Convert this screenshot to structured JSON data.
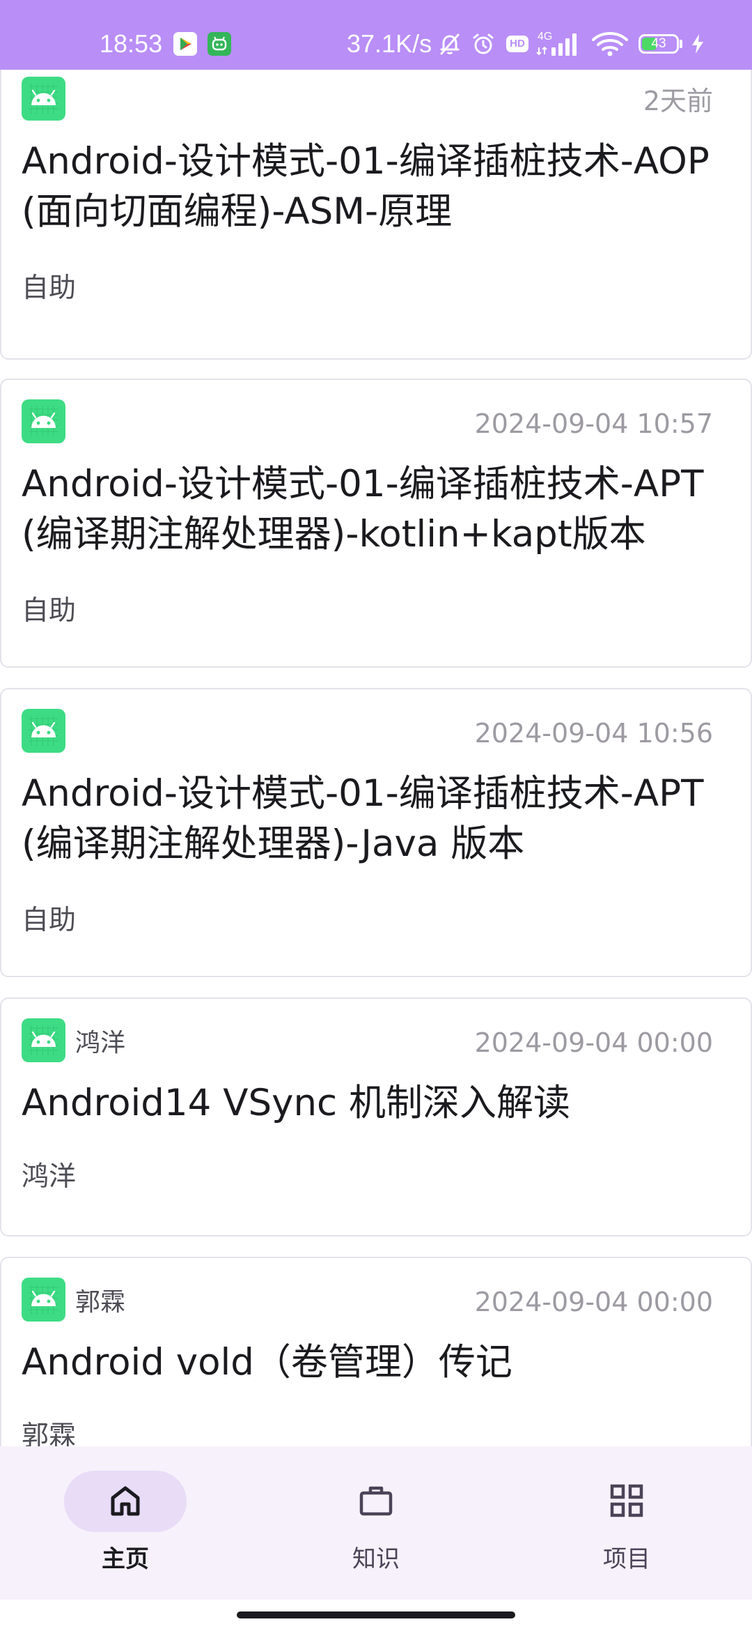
{
  "status_bar": {
    "time": "18:53",
    "network_speed": "37.1K/s",
    "hd_label": "HD",
    "network_type": "4G",
    "battery_level": "43",
    "battery_fraction": 0.43,
    "icons": [
      "play-store-icon",
      "green-app-icon",
      "mute-bell-icon",
      "alarm-icon",
      "hd-icon",
      "signal-icon",
      "wifi-icon",
      "battery-icon",
      "charging-icon"
    ]
  },
  "articles": [
    {
      "author": "",
      "date": "2天前",
      "title": "Android-设计模式-01-编译插桩技术-AOP(面向切面编程)-ASM-原理",
      "chapter": "自助"
    },
    {
      "author": "",
      "date": "2024-09-04 10:57",
      "title": "Android-设计模式-01-编译插桩技术-APT(编译期注解处理器)-kotlin+kapt版本",
      "chapter": "自助"
    },
    {
      "author": "",
      "date": "2024-09-04 10:56",
      "title": "Android-设计模式-01-编译插桩技术-APT(编译期注解处理器)-Java 版本",
      "chapter": "自助"
    },
    {
      "author": "鸿洋",
      "date": "2024-09-04 00:00",
      "title": "Android14 VSync 机制深入解读",
      "chapter": "鸿洋"
    },
    {
      "author": "郭霖",
      "date": "2024-09-04 00:00",
      "title": "Android vold（卷管理）传记",
      "chapter": "郭霖"
    }
  ],
  "bottom_nav": {
    "items": [
      {
        "label": "主页",
        "icon": "home-icon",
        "active": true
      },
      {
        "label": "知识",
        "icon": "briefcase-icon",
        "active": false
      },
      {
        "label": "项目",
        "icon": "grid-icon",
        "active": false
      }
    ]
  },
  "colors": {
    "status_bar": "#b98ef7",
    "avatar": "#3ddc84",
    "nav_background": "#f7f1fb",
    "nav_indicator": "#e8dcf7",
    "date_text": "#9d9aa2"
  }
}
